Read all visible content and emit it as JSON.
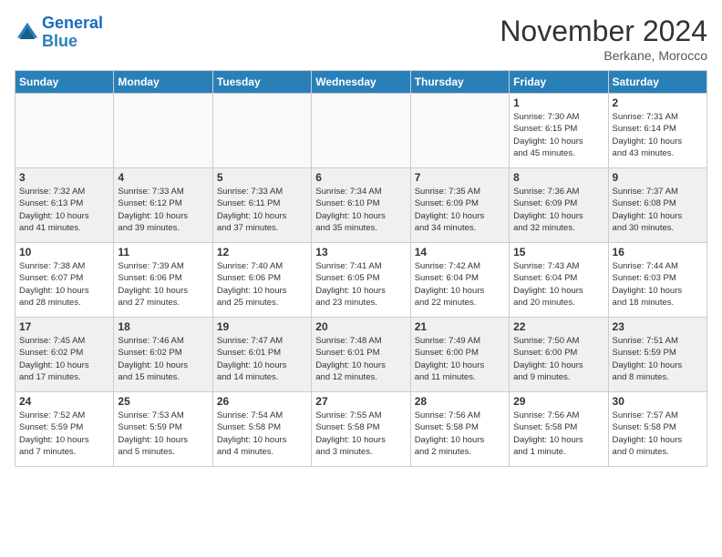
{
  "header": {
    "logo_line1": "General",
    "logo_line2": "Blue",
    "month": "November 2024",
    "location": "Berkane, Morocco"
  },
  "days_of_week": [
    "Sunday",
    "Monday",
    "Tuesday",
    "Wednesday",
    "Thursday",
    "Friday",
    "Saturday"
  ],
  "weeks": [
    [
      {
        "day": "",
        "info": ""
      },
      {
        "day": "",
        "info": ""
      },
      {
        "day": "",
        "info": ""
      },
      {
        "day": "",
        "info": ""
      },
      {
        "day": "",
        "info": ""
      },
      {
        "day": "1",
        "info": "Sunrise: 7:30 AM\nSunset: 6:15 PM\nDaylight: 10 hours\nand 45 minutes."
      },
      {
        "day": "2",
        "info": "Sunrise: 7:31 AM\nSunset: 6:14 PM\nDaylight: 10 hours\nand 43 minutes."
      }
    ],
    [
      {
        "day": "3",
        "info": "Sunrise: 7:32 AM\nSunset: 6:13 PM\nDaylight: 10 hours\nand 41 minutes."
      },
      {
        "day": "4",
        "info": "Sunrise: 7:33 AM\nSunset: 6:12 PM\nDaylight: 10 hours\nand 39 minutes."
      },
      {
        "day": "5",
        "info": "Sunrise: 7:33 AM\nSunset: 6:11 PM\nDaylight: 10 hours\nand 37 minutes."
      },
      {
        "day": "6",
        "info": "Sunrise: 7:34 AM\nSunset: 6:10 PM\nDaylight: 10 hours\nand 35 minutes."
      },
      {
        "day": "7",
        "info": "Sunrise: 7:35 AM\nSunset: 6:09 PM\nDaylight: 10 hours\nand 34 minutes."
      },
      {
        "day": "8",
        "info": "Sunrise: 7:36 AM\nSunset: 6:09 PM\nDaylight: 10 hours\nand 32 minutes."
      },
      {
        "day": "9",
        "info": "Sunrise: 7:37 AM\nSunset: 6:08 PM\nDaylight: 10 hours\nand 30 minutes."
      }
    ],
    [
      {
        "day": "10",
        "info": "Sunrise: 7:38 AM\nSunset: 6:07 PM\nDaylight: 10 hours\nand 28 minutes."
      },
      {
        "day": "11",
        "info": "Sunrise: 7:39 AM\nSunset: 6:06 PM\nDaylight: 10 hours\nand 27 minutes."
      },
      {
        "day": "12",
        "info": "Sunrise: 7:40 AM\nSunset: 6:06 PM\nDaylight: 10 hours\nand 25 minutes."
      },
      {
        "day": "13",
        "info": "Sunrise: 7:41 AM\nSunset: 6:05 PM\nDaylight: 10 hours\nand 23 minutes."
      },
      {
        "day": "14",
        "info": "Sunrise: 7:42 AM\nSunset: 6:04 PM\nDaylight: 10 hours\nand 22 minutes."
      },
      {
        "day": "15",
        "info": "Sunrise: 7:43 AM\nSunset: 6:04 PM\nDaylight: 10 hours\nand 20 minutes."
      },
      {
        "day": "16",
        "info": "Sunrise: 7:44 AM\nSunset: 6:03 PM\nDaylight: 10 hours\nand 18 minutes."
      }
    ],
    [
      {
        "day": "17",
        "info": "Sunrise: 7:45 AM\nSunset: 6:02 PM\nDaylight: 10 hours\nand 17 minutes."
      },
      {
        "day": "18",
        "info": "Sunrise: 7:46 AM\nSunset: 6:02 PM\nDaylight: 10 hours\nand 15 minutes."
      },
      {
        "day": "19",
        "info": "Sunrise: 7:47 AM\nSunset: 6:01 PM\nDaylight: 10 hours\nand 14 minutes."
      },
      {
        "day": "20",
        "info": "Sunrise: 7:48 AM\nSunset: 6:01 PM\nDaylight: 10 hours\nand 12 minutes."
      },
      {
        "day": "21",
        "info": "Sunrise: 7:49 AM\nSunset: 6:00 PM\nDaylight: 10 hours\nand 11 minutes."
      },
      {
        "day": "22",
        "info": "Sunrise: 7:50 AM\nSunset: 6:00 PM\nDaylight: 10 hours\nand 9 minutes."
      },
      {
        "day": "23",
        "info": "Sunrise: 7:51 AM\nSunset: 5:59 PM\nDaylight: 10 hours\nand 8 minutes."
      }
    ],
    [
      {
        "day": "24",
        "info": "Sunrise: 7:52 AM\nSunset: 5:59 PM\nDaylight: 10 hours\nand 7 minutes."
      },
      {
        "day": "25",
        "info": "Sunrise: 7:53 AM\nSunset: 5:59 PM\nDaylight: 10 hours\nand 5 minutes."
      },
      {
        "day": "26",
        "info": "Sunrise: 7:54 AM\nSunset: 5:58 PM\nDaylight: 10 hours\nand 4 minutes."
      },
      {
        "day": "27",
        "info": "Sunrise: 7:55 AM\nSunset: 5:58 PM\nDaylight: 10 hours\nand 3 minutes."
      },
      {
        "day": "28",
        "info": "Sunrise: 7:56 AM\nSunset: 5:58 PM\nDaylight: 10 hours\nand 2 minutes."
      },
      {
        "day": "29",
        "info": "Sunrise: 7:56 AM\nSunset: 5:58 PM\nDaylight: 10 hours\nand 1 minute."
      },
      {
        "day": "30",
        "info": "Sunrise: 7:57 AM\nSunset: 5:58 PM\nDaylight: 10 hours\nand 0 minutes."
      }
    ]
  ]
}
